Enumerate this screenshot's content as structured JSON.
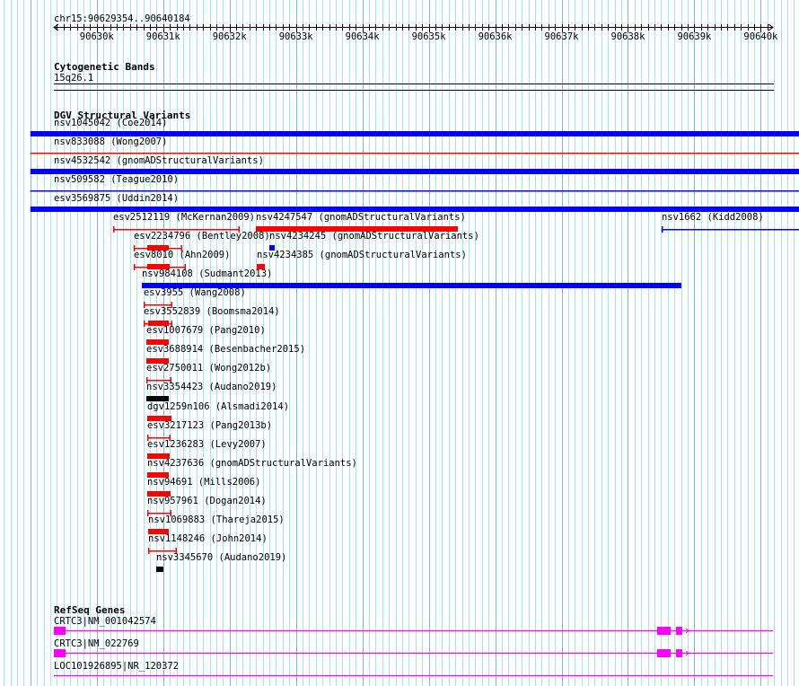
{
  "view": {
    "chrom": "chr15",
    "start": 90629354,
    "end": 90640184,
    "location_label": "chr15:90629354..90640184",
    "ruler_ticks": [
      {
        "pos": 90630000,
        "label": "90630k"
      },
      {
        "pos": 90631000,
        "label": "90631k"
      },
      {
        "pos": 90632000,
        "label": "90632k"
      },
      {
        "pos": 90633000,
        "label": "90633k"
      },
      {
        "pos": 90634000,
        "label": "90634k"
      },
      {
        "pos": 90635000,
        "label": "90635k"
      },
      {
        "pos": 90636000,
        "label": "90636k"
      },
      {
        "pos": 90637000,
        "label": "90637k"
      },
      {
        "pos": 90638000,
        "label": "90638k"
      },
      {
        "pos": 90639000,
        "label": "90639k"
      },
      {
        "pos": 90640000,
        "label": "90640k"
      }
    ]
  },
  "colors": {
    "loss": "#ff0000",
    "gain": "#0000ff",
    "other": "#000000",
    "gene": "#ff00ff",
    "grid_minor": "#a6e6ee",
    "grid_major": "#80b4e4"
  },
  "tracks": {
    "cytobands": {
      "title": "Cytogenetic Bands",
      "band": "15q26.1"
    },
    "dgv": {
      "title": "DGV Structural Variants",
      "rows": [
        [
          {
            "label": "nsv1045042 (Coe2014)",
            "start": 90629000,
            "end": 90641000,
            "color": "gain",
            "style": "thick"
          }
        ],
        [
          {
            "label": "nsv833088 (Wong2007)",
            "start": 90629000,
            "end": 90641000,
            "color": "loss",
            "style": "line"
          }
        ],
        [
          {
            "label": "nsv4532542 (gnomADStructuralVariants)",
            "start": 90629000,
            "end": 90641000,
            "color": "gain",
            "style": "thick"
          }
        ],
        [
          {
            "label": "nsv509582 (Teague2010)",
            "start": 90629000,
            "end": 90641000,
            "color": "gain",
            "style": "line"
          }
        ],
        [
          {
            "label": "esv3569875 (Uddin2014)",
            "start": 90629000,
            "end": 90641000,
            "color": "gain",
            "style": "thick"
          }
        ],
        [
          {
            "label": "esv2512119 (McKernan2009)",
            "start": 90630246,
            "end": 90632153,
            "color": "loss",
            "style": "capped"
          },
          {
            "label": "nsv4247547 (gnomADStructuralVariants)",
            "start": 90632396,
            "end": 90635438,
            "color": "loss",
            "style": "thick"
          },
          {
            "label": "nsv1662 (Kidd2008)",
            "start": 90638507,
            "end": 90641000,
            "color": "gain",
            "style": "capped"
          }
        ],
        [
          {
            "label": "esv2234796 (Bentley2008)",
            "start": 90630557,
            "end": 90631287,
            "inner_start": 90630760,
            "inner_end": 90631085,
            "color": "loss",
            "style": "capped"
          },
          {
            "label": "nsv4234245 (gnomADStructuralVariants)",
            "start": 90632599,
            "end": 90632680,
            "color": "gain",
            "style": "thick"
          }
        ],
        [
          {
            "label": "esv8010 (Ahn2009)",
            "start": 90630557,
            "end": 90631341,
            "inner_start": 90630760,
            "inner_end": 90631098,
            "color": "loss",
            "style": "capped"
          },
          {
            "label": "nsv4234385 (gnomADStructuralVariants)",
            "start": 90632410,
            "end": 90632531,
            "color": "loss",
            "style": "thick"
          }
        ],
        [
          {
            "label": "nsv984108 (Sudmant2013)",
            "start": 90630679,
            "end": 90638804,
            "color": "gain",
            "style": "thick"
          }
        ],
        [
          {
            "label": "esv3955 (Wang2008)",
            "start": 90630706,
            "end": 90631139,
            "color": "loss",
            "style": "capped"
          }
        ],
        [
          {
            "label": "esv3552839 (Boomsma2014)",
            "start": 90630706,
            "end": 90631139,
            "inner_start": 90630774,
            "inner_end": 90631085,
            "color": "loss",
            "style": "capped"
          }
        ],
        [
          {
            "label": "esv1007679 (Pang2010)",
            "start": 90630747,
            "end": 90631085,
            "color": "loss",
            "style": "thick"
          }
        ],
        [
          {
            "label": "esv3688914 (Besenbacher2015)",
            "start": 90630747,
            "end": 90631085,
            "color": "loss",
            "style": "thick"
          }
        ],
        [
          {
            "label": "esv2750011 (Wong2012b)",
            "start": 90630747,
            "end": 90631125,
            "color": "loss",
            "style": "capped"
          }
        ],
        [
          {
            "label": "nsv3354423 (Audano2019)",
            "start": 90630747,
            "end": 90631085,
            "color": "other",
            "style": "thick"
          }
        ],
        [
          {
            "label": "dgv1259n106 (Alsmadi2014)",
            "start": 90630760,
            "end": 90631125,
            "color": "loss",
            "style": "thick"
          }
        ],
        [
          {
            "label": "esv3217123 (Pang2013b)",
            "start": 90630760,
            "end": 90631112,
            "color": "loss",
            "style": "capped"
          }
        ],
        [
          {
            "label": "esv1236283 (Levy2007)",
            "start": 90630760,
            "end": 90631098,
            "color": "loss",
            "style": "thick"
          }
        ],
        [
          {
            "label": "nsv4237636 (gnomADStructuralVariants)",
            "start": 90630760,
            "end": 90631085,
            "color": "loss",
            "style": "thick"
          }
        ],
        [
          {
            "label": "nsv94691 (Mills2006)",
            "start": 90630760,
            "end": 90631112,
            "color": "loss",
            "style": "thick"
          }
        ],
        [
          {
            "label": "nsv957961 (Dogan2014)",
            "start": 90630760,
            "end": 90631125,
            "color": "loss",
            "style": "capped"
          }
        ],
        [
          {
            "label": "nsv1069883 (Thareja2015)",
            "start": 90630774,
            "end": 90631085,
            "color": "loss",
            "style": "thick"
          }
        ],
        [
          {
            "label": "nsv1148246 (John2014)",
            "start": 90630774,
            "end": 90631206,
            "color": "loss",
            "style": "capped"
          }
        ],
        [
          {
            "label": "nsv3345670 (Audano2019)",
            "start": 90630895,
            "end": 90631003,
            "color": "other",
            "style": "thick"
          }
        ]
      ]
    },
    "refseq": {
      "title": "RefSeq Genes",
      "genes": [
        {
          "label": "CRTC3|NM_001042574",
          "start": 90629000,
          "end": 90641000,
          "exons": [
            [
              90629000,
              90629530
            ],
            [
              90638440,
              90638643
            ],
            [
              90638724,
              90638818
            ]
          ]
        },
        {
          "label": "CRTC3|NM_022769",
          "start": 90629000,
          "end": 90641000,
          "exons": [
            [
              90629000,
              90629530
            ],
            [
              90638440,
              90638643
            ],
            [
              90638724,
              90638818
            ]
          ]
        },
        {
          "label": "LOC101926895|NR_120372",
          "start": 90629000,
          "end": 90641000,
          "exons": []
        }
      ]
    }
  }
}
